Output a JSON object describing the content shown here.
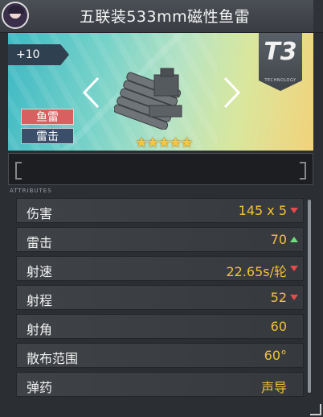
{
  "header": {
    "title": "五联装533mm磁性鱼雷",
    "avatar_icon": "commander-avatar"
  },
  "banner": {
    "level": "+10",
    "tier": "T3",
    "tier_caption": "TECHNOLOGY",
    "tags": [
      "鱼雷",
      "雷击"
    ],
    "stars": "★★★★★",
    "rarity_stars": 5
  },
  "description": {
    "text": ""
  },
  "attributes_label": "ATTRIBUTES",
  "stats": [
    {
      "name": "伤害",
      "value": "145 x 5",
      "change": "down"
    },
    {
      "name": "雷击",
      "value": "70",
      "change": "up"
    },
    {
      "name": "射速",
      "value": "22.65s/轮",
      "change": "down"
    },
    {
      "name": "射程",
      "value": "52",
      "change": "down"
    },
    {
      "name": "射角",
      "value": "60",
      "change": ""
    },
    {
      "name": "散布范围",
      "value": "60°",
      "change": ""
    },
    {
      "name": "弹药",
      "value": "声导",
      "change": ""
    }
  ],
  "colors": {
    "value": "#f2c23a",
    "down": "#e84a4a",
    "up": "#6de07a",
    "torpedo_tag": "#d96060",
    "attack_tag": "#3b4f6a"
  }
}
